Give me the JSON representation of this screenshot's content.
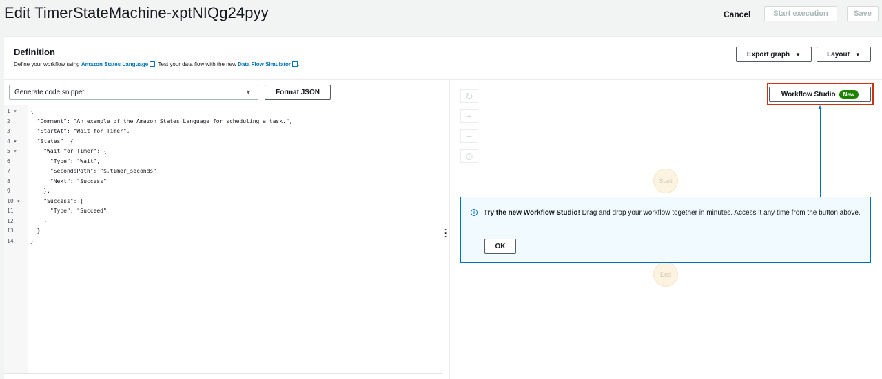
{
  "header": {
    "title": "Edit TimerStateMachine-xptNIQg24pyy",
    "cancel_label": "Cancel",
    "start_execution_label": "Start execution",
    "save_label": "Save"
  },
  "definition": {
    "title": "Definition",
    "desc_prefix": "Define your workflow using ",
    "asl_link": "Amazon States Language",
    "desc_middle": ". Test your data flow with the new ",
    "simulator_link": "Data Flow Simulator",
    "desc_suffix": ".",
    "export_graph_label": "Export graph",
    "layout_label": "Layout"
  },
  "editor": {
    "snippet_select": "Generate code snippet",
    "format_json_label": "Format JSON",
    "line_numbers": [
      "1 ▾",
      "2",
      "3",
      "4 ▾",
      "5 ▾",
      "6",
      "7",
      "8",
      "9",
      "10 ▾",
      "11",
      "12",
      "13",
      "14"
    ],
    "lines": [
      "{",
      "  \"Comment\": \"An example of the Amazon States Language for scheduling a task.\",",
      "  \"StartAt\": \"Wait for Timer\",",
      "  \"States\": {",
      "    \"Wait for Timer\": {",
      "      \"Type\": \"Wait\",",
      "      \"SecondsPath\": \"$.timer_seconds\",",
      "      \"Next\": \"Success\"",
      "    },",
      "    \"Success\": {",
      "      \"Type\": \"Succeed\"",
      "    }",
      "  }",
      "}"
    ]
  },
  "graph": {
    "controls": [
      "refresh-icon",
      "zoom-in-icon",
      "zoom-out-icon",
      "center-icon"
    ],
    "workflow_studio_label": "Workflow Studio",
    "new_badge": "New",
    "start_node": "Start",
    "end_node": "End",
    "info_bold": "Try the new Workflow Studio!",
    "info_text": " Drag and drop your workflow together in minutes. Access it any time from the button above.",
    "ok_label": "OK"
  },
  "colors": {
    "accent": "#0073bb",
    "highlight": "#d13212",
    "badge": "#1d8102"
  }
}
